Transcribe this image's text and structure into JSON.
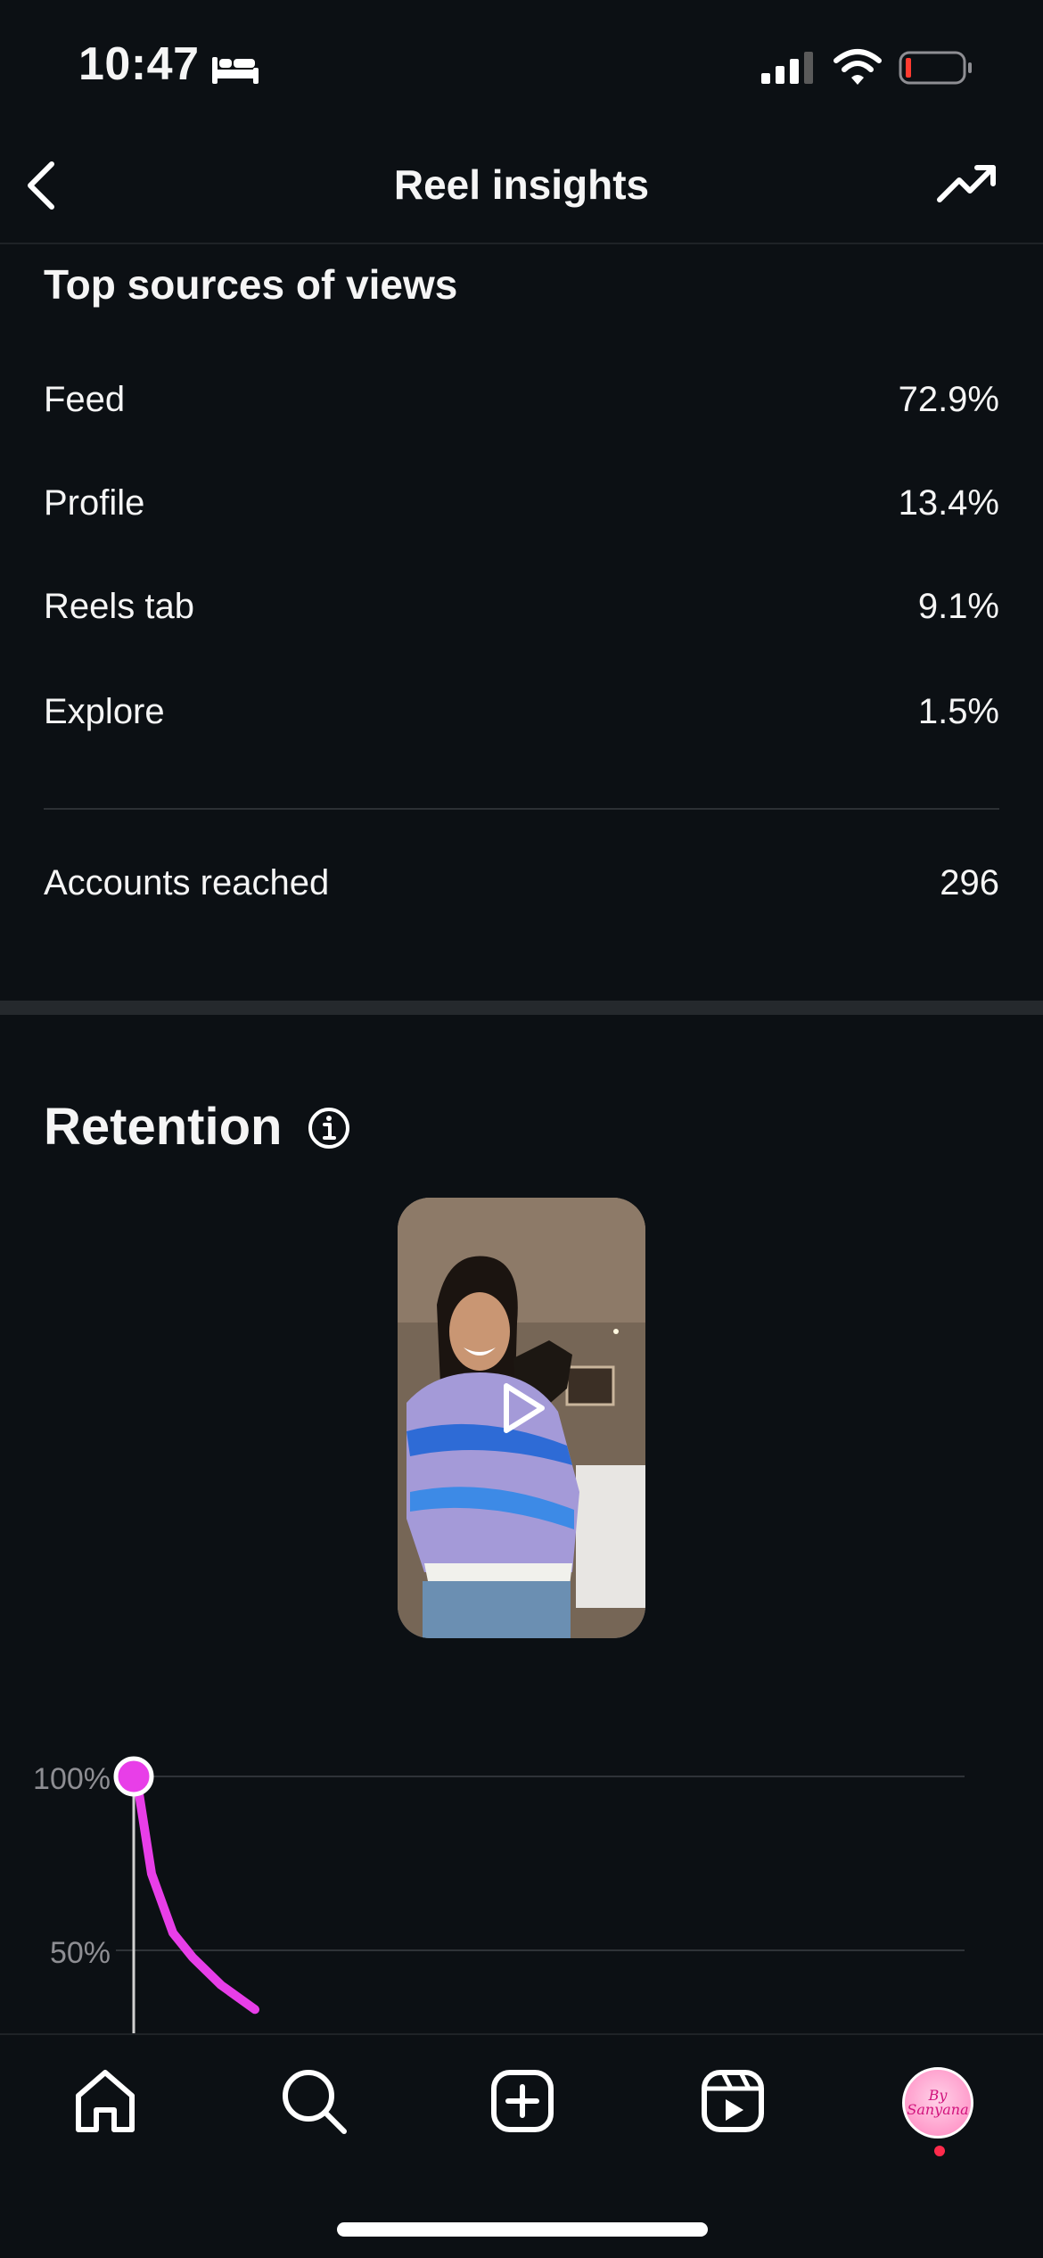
{
  "status_bar": {
    "time": "10:47",
    "icons": [
      "bed-icon",
      "cellular-signal-icon",
      "wifi-icon",
      "battery-low-icon"
    ],
    "battery_color": "#ff3b30"
  },
  "header": {
    "title": "Reel insights",
    "back_icon": "chevron-left-icon",
    "right_icon": "trending-up-icon"
  },
  "sources": {
    "title": "Top sources of views",
    "rows": [
      {
        "label": "Feed",
        "value": "72.9%"
      },
      {
        "label": "Profile",
        "value": "13.4%"
      },
      {
        "label": "Reels tab",
        "value": "9.1%"
      },
      {
        "label": "Explore",
        "value": "1.5%"
      }
    ],
    "accounts_reached": {
      "label": "Accounts reached",
      "value": "296"
    }
  },
  "retention": {
    "title": "Retention",
    "info_icon": "info-icon",
    "video": {
      "play_icon": "play-icon"
    },
    "accent_color": "#e83ee8"
  },
  "chart_data": {
    "type": "line",
    "y_ticks": [
      "100%",
      "50%"
    ],
    "series": [
      {
        "values": [
          100,
          95,
          72,
          55,
          48,
          40,
          33
        ]
      }
    ],
    "x": [
      0,
      1,
      2,
      3,
      4,
      5,
      6
    ],
    "ylim": [
      0,
      100
    ],
    "grid": true
  },
  "bottom_nav": {
    "items": [
      "home-icon",
      "search-icon",
      "create-icon",
      "reels-icon",
      "profile-avatar"
    ],
    "avatar_text_line1": "By",
    "avatar_text_line2": "Sanyana"
  }
}
